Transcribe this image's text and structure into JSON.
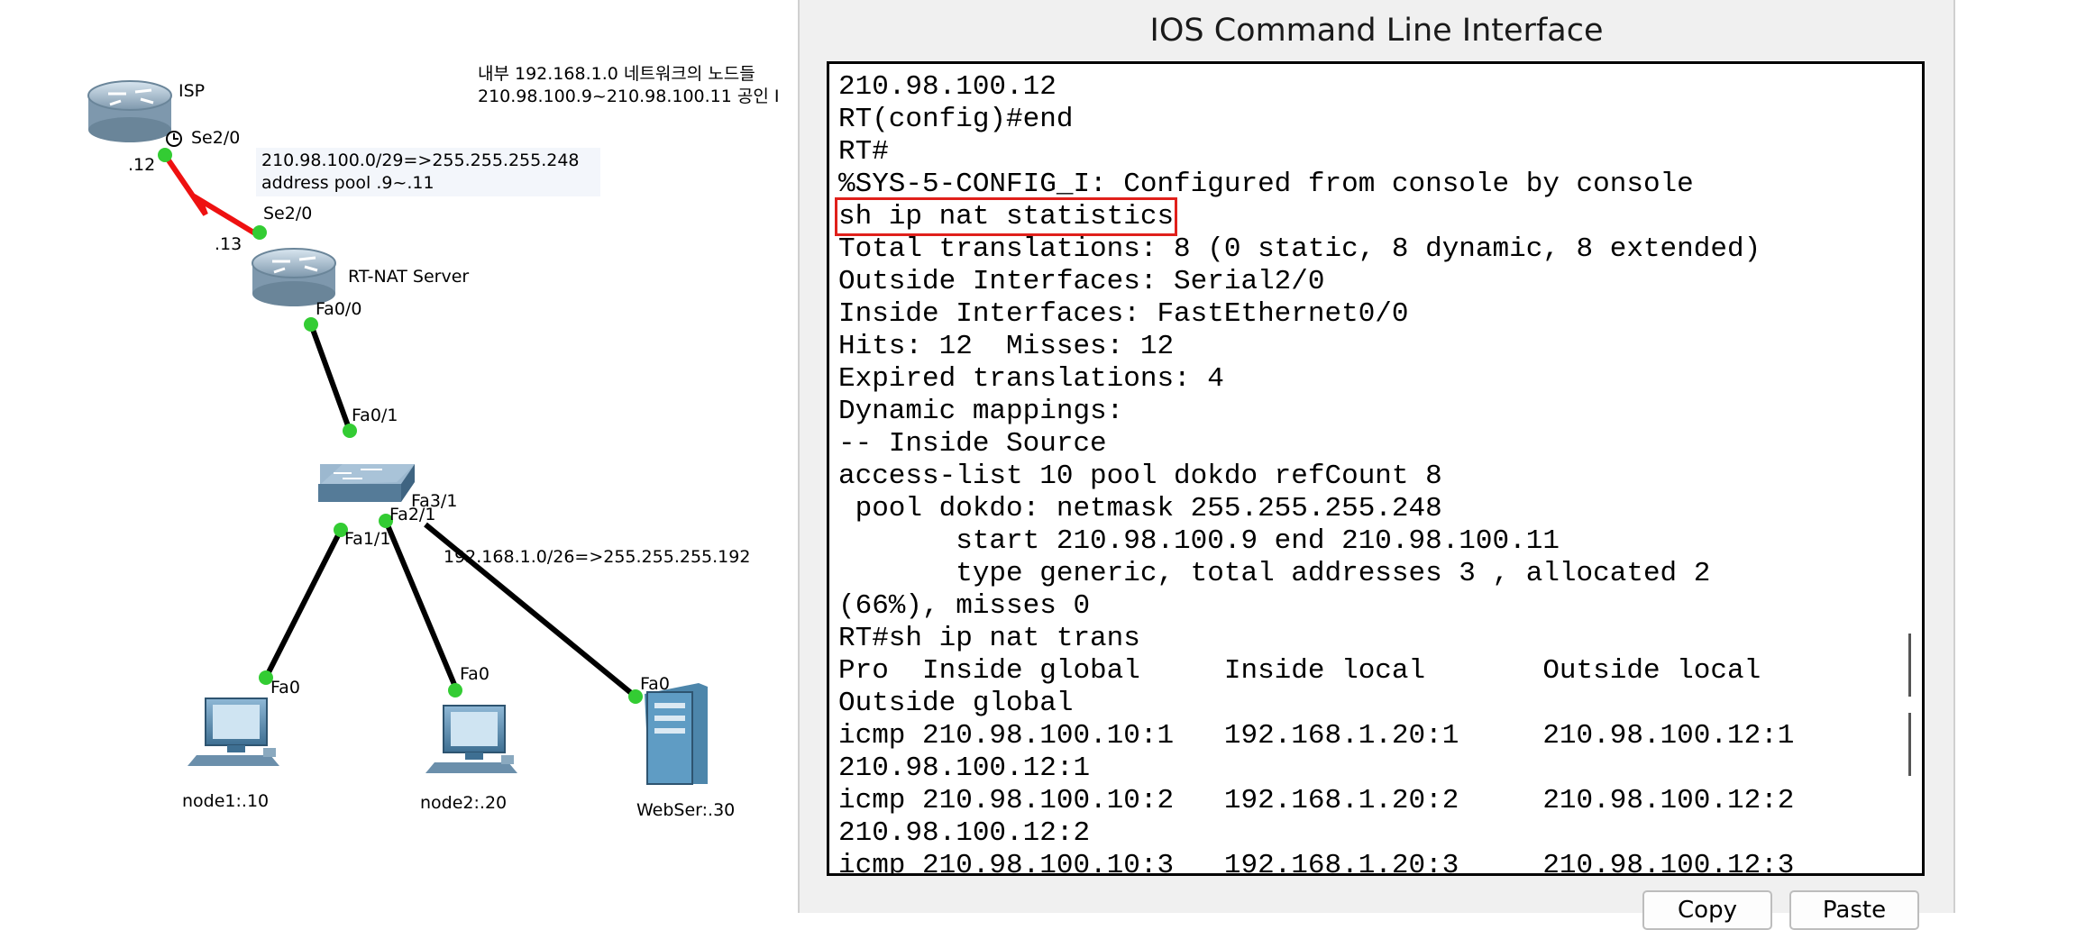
{
  "topology": {
    "note_top_line1": "내부 192.168.1.0 네트워크의 노드들",
    "note_top_line2": "210.98.100.9~210.98.100.11 공인 I",
    "isp_label": "ISP",
    "isp_port": "Se2/0",
    "isp_ip": ".12",
    "wan_note_line1": "210.98.100.0/29=>255.255.255.248",
    "wan_note_line2": "address pool .9~.11",
    "rt_port_se": "Se2/0",
    "rt_ip": ".13",
    "rt_label": "RT-NAT Server",
    "rt_port_fa": "Fa0/0",
    "sw_port_up": "Fa0/1",
    "sw_port_fa31": "Fa3/1",
    "sw_port_fa21": "Fa2/1",
    "sw_port_fa11": "Fa1/1",
    "lan_note": "192.168.1.0/26=>255.255.255.192",
    "node1_port": "Fa0",
    "node2_port": "Fa0",
    "web_port": "Fa0",
    "node1_label": "node1:.10",
    "node2_label": "node2:.20",
    "web_label": "WebSer:.30"
  },
  "cli": {
    "title": "IOS Command Line Interface",
    "lines": [
      "210.98.100.12",
      "RT(config)#end",
      "RT#",
      "%SYS-5-CONFIG_I: Configured from console by console",
      "sh ip nat statistics",
      "Total translations: 8 (0 static, 8 dynamic, 8 extended)",
      "Outside Interfaces: Serial2/0",
      "Inside Interfaces: FastEthernet0/0",
      "Hits: 12  Misses: 12",
      "Expired translations: 4",
      "Dynamic mappings:",
      "-- Inside Source",
      "access-list 10 pool dokdo refCount 8",
      " pool dokdo: netmask 255.255.255.248",
      "       start 210.98.100.9 end 210.98.100.11",
      "       type generic, total addresses 3 , allocated 2",
      "(66%), misses 0",
      "RT#sh ip nat trans",
      "Pro  Inside global     Inside local       Outside local",
      "Outside global",
      "icmp 210.98.100.10:1   192.168.1.20:1     210.98.100.12:1",
      "210.98.100.12:1",
      "icmp 210.98.100.10:2   192.168.1.20:2     210.98.100.12:2",
      "210.98.100.12:2",
      "icmp 210.98.100.10:3   192.168.1.20:3     210.98.100.12:3"
    ],
    "copy_label": "Copy",
    "paste_label": "Paste"
  },
  "colors": {
    "highlight_box": "#e0201b",
    "link_up": "#33cc33",
    "wan_link": "#ee1111"
  }
}
